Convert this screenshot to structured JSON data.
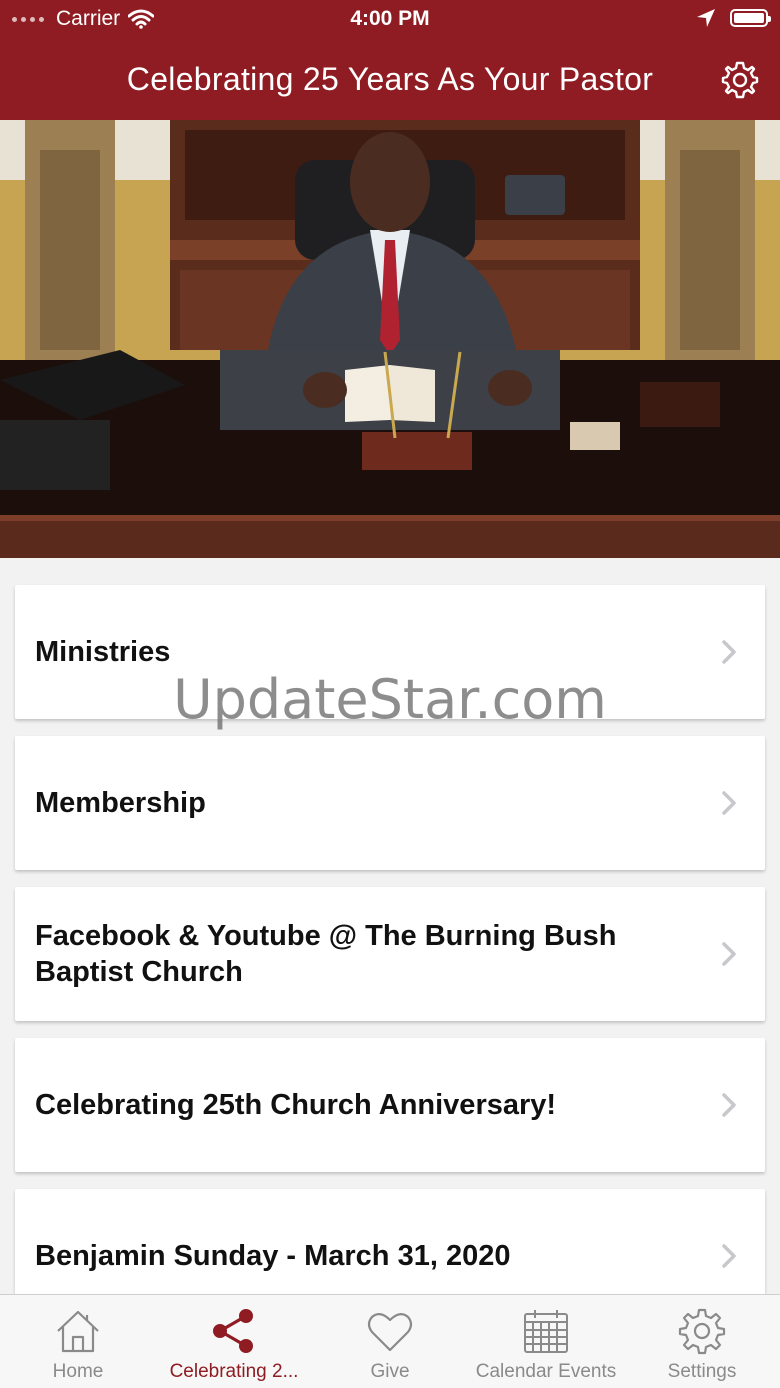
{
  "status": {
    "carrier": "Carrier",
    "time": "4:00 PM",
    "battery_level": 1.0
  },
  "nav": {
    "title": "Celebrating 25 Years As Your Pastor",
    "settings_icon": "gear-icon"
  },
  "hero": {
    "description_icon": "pastor-photo"
  },
  "items": [
    {
      "label": "Ministries"
    },
    {
      "label": "Membership"
    },
    {
      "label": "Facebook & Youtube @ The Burning Bush Baptist Church"
    },
    {
      "label": "Celebrating 25th Church Anniversary!"
    },
    {
      "label": "Benjamin Sunday - March 31, 2020"
    }
  ],
  "watermark": "UpdateStar.com",
  "tabs": [
    {
      "label": "Home",
      "icon": "home-icon"
    },
    {
      "label": "Celebrating 2...",
      "icon": "share-icon"
    },
    {
      "label": "Give",
      "icon": "heart-icon"
    },
    {
      "label": "Calendar Events",
      "icon": "calendar-icon"
    },
    {
      "label": "Settings",
      "icon": "gear-icon"
    }
  ],
  "colors": {
    "brand": "#8e1c22",
    "inactive": "#8a8a8a"
  }
}
